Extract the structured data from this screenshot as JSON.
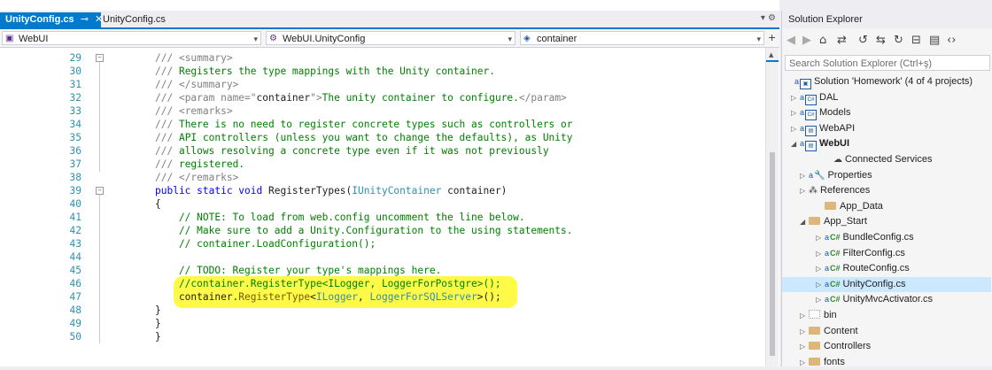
{
  "tabs": [
    {
      "label": "UnityConfig.cs",
      "active": true
    },
    {
      "label": "UnityConfig.cs",
      "active": false
    }
  ],
  "navbar": {
    "project": "WebUI",
    "class": "WebUI.UnityConfig",
    "member": "container"
  },
  "editor": {
    "lines": [
      {
        "n": "29",
        "parts": [
          {
            "t": "/// ",
            "c": "c-gray"
          },
          {
            "t": "<summary>",
            "c": "c-gray"
          }
        ]
      },
      {
        "n": "30",
        "parts": [
          {
            "t": "/// ",
            "c": "c-gray"
          },
          {
            "t": "Registers the type mappings with the Unity container.",
            "c": "c-green"
          }
        ]
      },
      {
        "n": "31",
        "parts": [
          {
            "t": "/// ",
            "c": "c-gray"
          },
          {
            "t": "</summary>",
            "c": "c-gray"
          }
        ]
      },
      {
        "n": "32",
        "parts": [
          {
            "t": "/// ",
            "c": "c-gray"
          },
          {
            "t": "<param name=\"",
            "c": "c-gray"
          },
          {
            "t": "container",
            "c": "c-black"
          },
          {
            "t": "\">",
            "c": "c-gray"
          },
          {
            "t": "The unity container to configure.",
            "c": "c-green"
          },
          {
            "t": "</param>",
            "c": "c-gray"
          }
        ]
      },
      {
        "n": "33",
        "parts": [
          {
            "t": "/// ",
            "c": "c-gray"
          },
          {
            "t": "<remarks>",
            "c": "c-gray"
          }
        ]
      },
      {
        "n": "34",
        "parts": [
          {
            "t": "/// ",
            "c": "c-gray"
          },
          {
            "t": "There is no need to register concrete types such as controllers or",
            "c": "c-green"
          }
        ]
      },
      {
        "n": "35",
        "parts": [
          {
            "t": "/// ",
            "c": "c-gray"
          },
          {
            "t": "API controllers (unless you want to change the defaults), as Unity",
            "c": "c-green"
          }
        ]
      },
      {
        "n": "36",
        "parts": [
          {
            "t": "/// ",
            "c": "c-gray"
          },
          {
            "t": "allows resolving a concrete type even if it was not previously",
            "c": "c-green"
          }
        ]
      },
      {
        "n": "37",
        "parts": [
          {
            "t": "/// ",
            "c": "c-gray"
          },
          {
            "t": "registered.",
            "c": "c-green"
          }
        ]
      },
      {
        "n": "38",
        "parts": [
          {
            "t": "/// ",
            "c": "c-gray"
          },
          {
            "t": "</remarks>",
            "c": "c-gray"
          }
        ]
      },
      {
        "n": "39",
        "parts": [
          {
            "t": "public static void ",
            "c": "c-blue"
          },
          {
            "t": "RegisterTypes(",
            "c": "c-black"
          },
          {
            "t": "IUnityContainer",
            "c": "c-teal"
          },
          {
            "t": " container)",
            "c": "c-black"
          }
        ]
      },
      {
        "n": "40",
        "parts": [
          {
            "t": "{",
            "c": "c-black"
          }
        ]
      },
      {
        "n": "41",
        "parts": [
          {
            "t": "    // NOTE: To load from web.config uncomment the line below.",
            "c": "c-green"
          }
        ]
      },
      {
        "n": "42",
        "parts": [
          {
            "t": "    // Make sure to add a Unity.Configuration to the using statements.",
            "c": "c-green"
          }
        ]
      },
      {
        "n": "43",
        "parts": [
          {
            "t": "    // container.LoadConfiguration();",
            "c": "c-green"
          }
        ]
      },
      {
        "n": "44",
        "parts": []
      },
      {
        "n": "45",
        "parts": [
          {
            "t": "    // TODO: Register your type's mappings here.",
            "c": "c-green"
          }
        ]
      },
      {
        "n": "46",
        "parts": [
          {
            "t": "    //container.RegisterType<ILogger, LoggerForPostgre>();",
            "c": "c-green"
          }
        ]
      },
      {
        "n": "47",
        "parts": [
          {
            "t": "    container.",
            "c": "c-black"
          },
          {
            "t": "RegisterType",
            "c": "c-olive"
          },
          {
            "t": "<",
            "c": "c-black"
          },
          {
            "t": "ILogger",
            "c": "c-teal"
          },
          {
            "t": ", ",
            "c": "c-black"
          },
          {
            "t": "LoggerForSQLServer",
            "c": "c-teal"
          },
          {
            "t": ">();",
            "c": "c-black"
          }
        ]
      },
      {
        "n": "48",
        "parts": [
          {
            "t": "}",
            "c": "c-black"
          }
        ]
      },
      {
        "n": "49",
        "parts": [
          {
            "t": "}",
            "c": "c-black"
          }
        ]
      },
      {
        "n": "50",
        "parts": [
          {
            "t": "}",
            "c": "c-black"
          }
        ]
      }
    ]
  },
  "solution_explorer": {
    "title": "Solution Explorer",
    "search_placeholder": "Search Solution Explorer (Ctrl+ş)",
    "items": [
      {
        "label": "Solution 'Homework' (4 of 4 projects)",
        "icon": "solution",
        "twisty": "",
        "bold": false,
        "selected": false
      },
      {
        "label": "DAL",
        "icon": "csproj",
        "twisty": "▷",
        "bold": false,
        "selected": false
      },
      {
        "label": "Models",
        "icon": "csproj",
        "twisty": "▷",
        "bold": false,
        "selected": false
      },
      {
        "label": "WebAPI",
        "icon": "webproj",
        "twisty": "▷",
        "bold": false,
        "selected": false
      },
      {
        "label": "WebUI",
        "icon": "webproj",
        "twisty": "◢",
        "bold": true,
        "selected": false
      },
      {
        "label": "Connected Services",
        "icon": "connected",
        "twisty": "",
        "bold": false,
        "selected": false
      },
      {
        "label": "Properties",
        "icon": "wrench",
        "twisty": "▷",
        "bold": false,
        "selected": false
      },
      {
        "label": "References",
        "icon": "references",
        "twisty": "▷",
        "bold": false,
        "selected": false
      },
      {
        "label": "App_Data",
        "icon": "folder",
        "twisty": "",
        "bold": false,
        "selected": false
      },
      {
        "label": "App_Start",
        "icon": "folder",
        "twisty": "◢",
        "bold": false,
        "selected": false
      },
      {
        "label": "BundleConfig.cs",
        "icon": "cs",
        "twisty": "▷",
        "bold": false,
        "selected": false
      },
      {
        "label": "FilterConfig.cs",
        "icon": "cs",
        "twisty": "▷",
        "bold": false,
        "selected": false
      },
      {
        "label": "RouteConfig.cs",
        "icon": "cs",
        "twisty": "▷",
        "bold": false,
        "selected": false
      },
      {
        "label": "UnityConfig.cs",
        "icon": "cs",
        "twisty": "▷",
        "bold": false,
        "selected": true
      },
      {
        "label": "UnityMvcActivator.cs",
        "icon": "cs",
        "twisty": "▷",
        "bold": false,
        "selected": false
      },
      {
        "label": "bin",
        "icon": "folder-dotted",
        "twisty": "▷",
        "bold": false,
        "selected": false
      },
      {
        "label": "Content",
        "icon": "folder",
        "twisty": "▷",
        "bold": false,
        "selected": false
      },
      {
        "label": "Controllers",
        "icon": "folder",
        "twisty": "▷",
        "bold": false,
        "selected": false
      },
      {
        "label": "fonts",
        "icon": "folder",
        "twisty": "▷",
        "bold": false,
        "selected": false
      }
    ]
  },
  "colors": {
    "accent": "#007acc",
    "highlight": "#fffa3d",
    "selection": "#cce8ff"
  }
}
